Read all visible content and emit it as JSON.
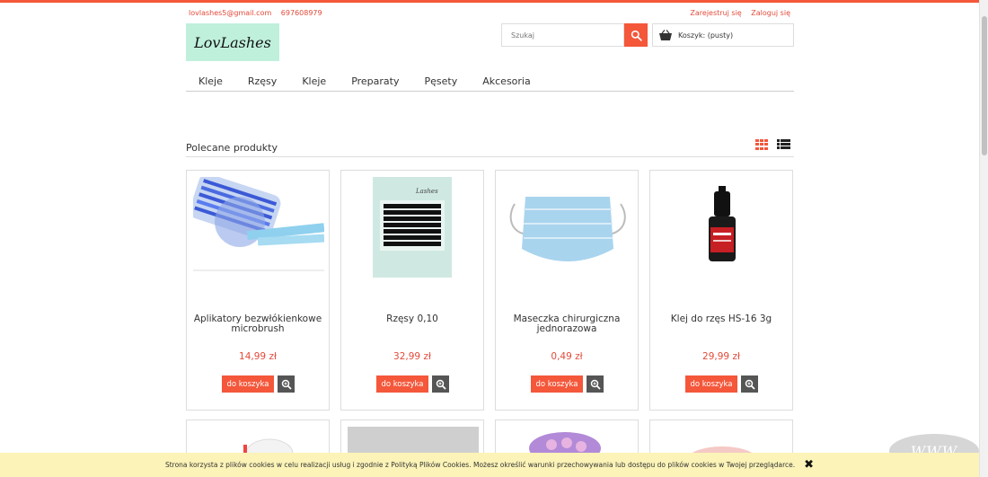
{
  "header": {
    "email": "lovlashes5@gmail.com",
    "phone": "697608979",
    "register": "Zarejestruj się",
    "login": "Zaloguj się",
    "logo_text": "LovLashes",
    "search_placeholder": "Szukaj",
    "cart_label": "Koszyk: (pusty)"
  },
  "menu": [
    "Kleje",
    "Rzęsy",
    "Kleje",
    "Preparaty",
    "Pęsety",
    "Akcesoria"
  ],
  "section_title": "Polecane produkty",
  "products": [
    {
      "name": "Aplikatory bezwłókienkowe microbrush",
      "price": "14,99 zł",
      "buy": "do koszyka"
    },
    {
      "name": "Rzęsy 0,10",
      "price": "32,99 zł",
      "buy": "do koszyka"
    },
    {
      "name": "Maseczka chirurgiczna jednorazowa",
      "price": "0,49 zł",
      "buy": "do koszyka"
    },
    {
      "name": "Klej do rzęs HS-16 3g",
      "price": "29,99 zł",
      "buy": "do koszyka"
    }
  ],
  "cookie_text": "Strona korzysta z plików cookies w celu realizacji usług i zgodnie z Polityką Plików Cookies. Możesz określić warunki przechowywania lub dostępu do plików cookies w Twojej przeglądarce.",
  "badge": "WWW",
  "colors": {
    "accent": "#f4573a",
    "price": "#e24b3b",
    "logo_bg": "#bff0dc",
    "cookie_bg": "#fbf3b7"
  }
}
